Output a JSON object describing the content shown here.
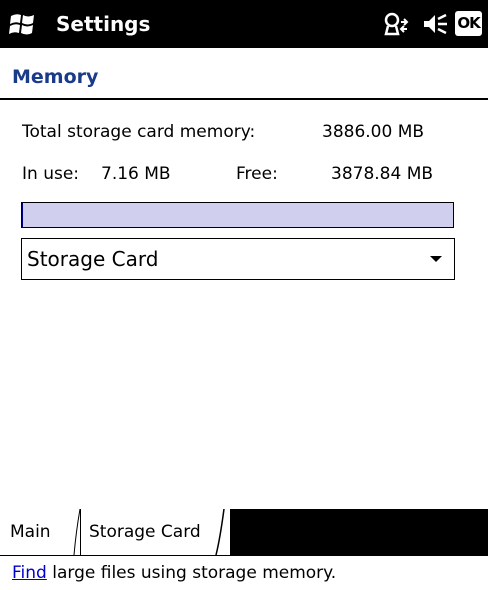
{
  "title_bar": {
    "title": "Settings",
    "ok_label": "OK",
    "start_icon": "windows-flag-icon",
    "connectivity_icon": "connectivity-icon",
    "volume_icon": "speaker-volume-icon"
  },
  "header": {
    "page_title": "Memory"
  },
  "memory": {
    "total_label": "Total storage card memory:",
    "total_value": "3886.00 MB",
    "in_use_label": "In use:",
    "in_use_value": "7.16 MB",
    "free_label": "Free:",
    "free_value": "3878.84 MB",
    "usage_fraction": 0.0018
  },
  "dropdown": {
    "selected": "Storage Card"
  },
  "tabs": [
    {
      "label": "Main",
      "active": false
    },
    {
      "label": "Storage Card",
      "active": true
    }
  ],
  "footer": {
    "link_text": "Find",
    "rest_text": " large files using storage memory."
  },
  "colors": {
    "header_accent": "#1a3a8a",
    "usage_bar_background": "#d0d0ee",
    "usage_bar_fill": "#000080",
    "link": "#0000cc"
  }
}
